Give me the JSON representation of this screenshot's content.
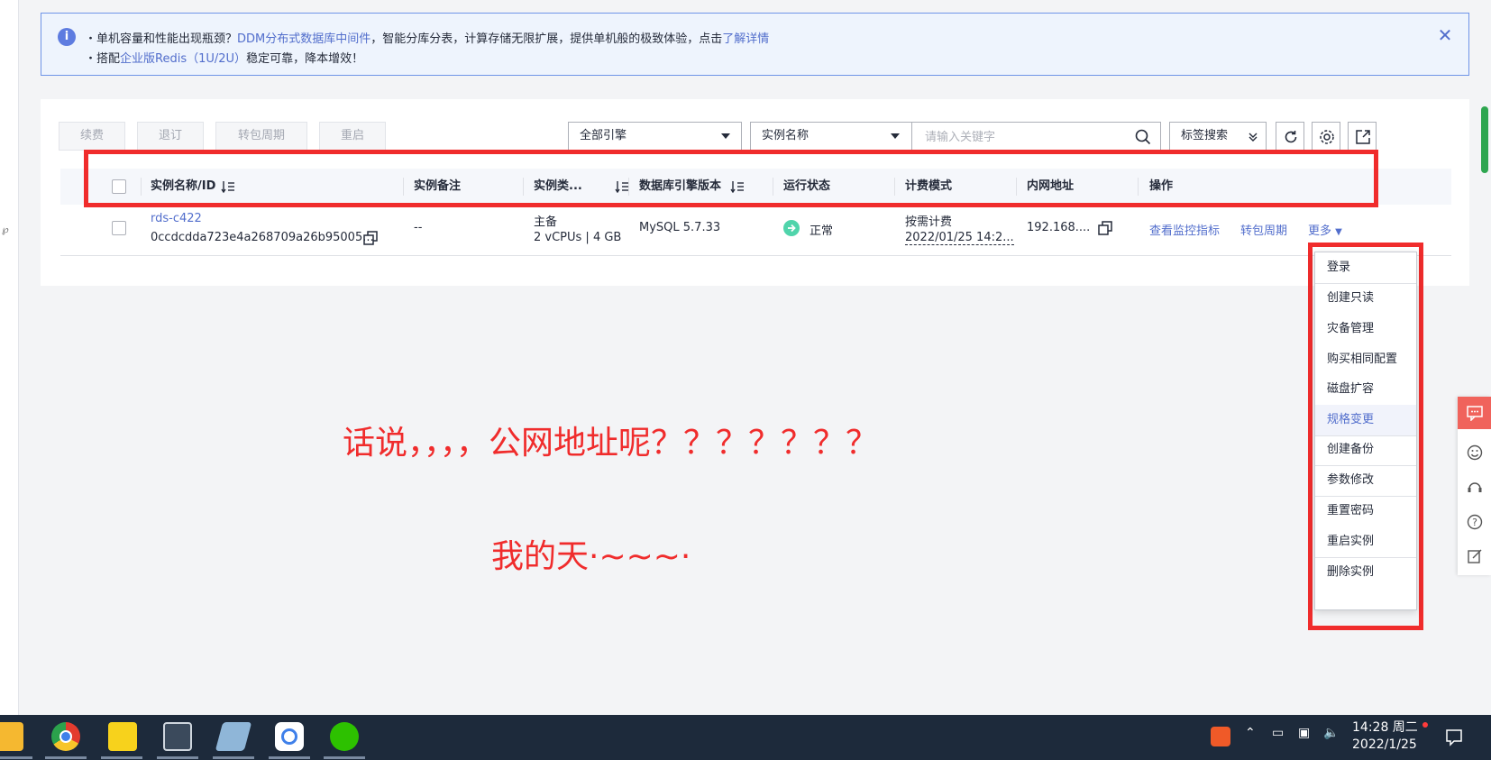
{
  "notice": {
    "line1_prefix": "・单机容量和性能出现瓶颈？",
    "line1_link": "DDM分布式数据库中间件",
    "line1_mid": "，智能分库分表，计算存储无限扩展，提供单机般的极致体验，点击",
    "line1_link2": "了解详情",
    "line2_prefix": "・搭配",
    "line2_link": "企业版Redis（1U/2U）",
    "line2_suffix": "稳定可靠，降本增效！"
  },
  "toolbar": {
    "renew": "续费",
    "unsubscribe": "退订",
    "change_billing": "转包周期",
    "restart": "重启",
    "engine_select": "全部引擎",
    "field_select": "实例名称",
    "search_placeholder": "请输入关键字",
    "tag_search": "标签搜索"
  },
  "table": {
    "headers": {
      "name": "实例名称/ID",
      "remark": "实例备注",
      "type": "实例类...",
      "engine": "数据库引擎版本",
      "status": "运行状态",
      "billing": "计费模式",
      "ip": "内网地址",
      "actions": "操作"
    },
    "rows": [
      {
        "name": "rds-c422",
        "id": "0ccdcdda723e4a268709a26b95005...",
        "remark": "--",
        "type_main": "主备",
        "type_spec": "2 vCPUs | 4 GB",
        "engine": "MySQL 5.7.33",
        "status": "正常",
        "billing_mode": "按需计费",
        "billing_time": "2022/01/25 14:2...",
        "ip": "192.168....",
        "action_monitor": "查看监控指标",
        "action_change": "转包周期",
        "action_more": "更多"
      }
    ]
  },
  "more_menu": [
    "登录",
    "创建只读",
    "灾备管理",
    "购买相同配置",
    "磁盘扩容",
    "规格变更",
    "创建备份",
    "参数修改",
    "重置密码",
    "重启实例",
    "删除实例"
  ],
  "annotations": {
    "line1": "话说，，，，公网地址呢？？？？？？？",
    "line2": "我的天·~~~·"
  },
  "taskbar": {
    "time": "14:28 周二",
    "date": "2022/1/25"
  },
  "colors": {
    "accent": "#526ecc",
    "annotation_red": "#f02c2c",
    "status_green": "#50d4ab"
  }
}
